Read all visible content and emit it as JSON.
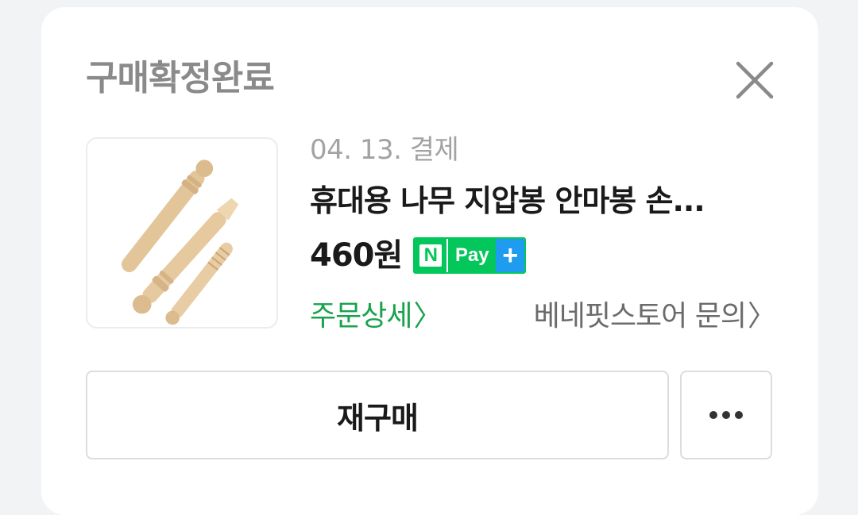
{
  "dialog": {
    "title": "구매확정완료",
    "close_icon": "close-icon"
  },
  "order": {
    "date": "04. 13. 결제",
    "product_name": "휴대용 나무 지압봉 안마봉 손...",
    "price": "460원",
    "npay": {
      "n_label": "N",
      "pay_label": "Pay",
      "plus_label": "+"
    },
    "detail_link": "주문상세",
    "inquiry_link": "베네핏스토어 문의",
    "chevron": "〉"
  },
  "actions": {
    "rebuy_label": "재구매",
    "more_icon": "more-icon"
  },
  "colors": {
    "title": "#8a8a8a",
    "detail_link": "#1aa24d",
    "npay_green": "#03c75a",
    "npay_blue": "#1e9cf0"
  }
}
